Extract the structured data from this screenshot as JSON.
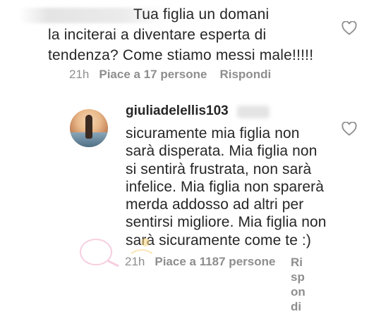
{
  "comment1": {
    "lines": [
      "Tua figlia un domani",
      "la inciterai a diventare esperta di",
      "tendenza? Come stiamo messi male!!!!!"
    ],
    "time": "21h",
    "likes": "Piace a 17 persone",
    "reply": "Rispondi",
    "like_icon": "heart-outline-icon"
  },
  "comment2": {
    "username": "giuliadelellis103",
    "lines": [
      "sicuramente mia figlia non",
      "sarà disperata. Mia figlia non",
      "si sentirà frustrata, non sarà",
      "infelice. Mia figlia non sparerà",
      "merda addosso ad altri per",
      "sentirsi migliore. Mia figlia non",
      "sarà sicuramente come te :)"
    ],
    "time": "21h",
    "likes": "Piace a 1187 persone",
    "reply_fragments": [
      "Ri",
      "sp",
      "on",
      "di"
    ],
    "like_icon": "heart-outline-icon"
  },
  "colors": {
    "text": "#262626",
    "meta": "#8e8e8e",
    "background": "#ffffff"
  }
}
